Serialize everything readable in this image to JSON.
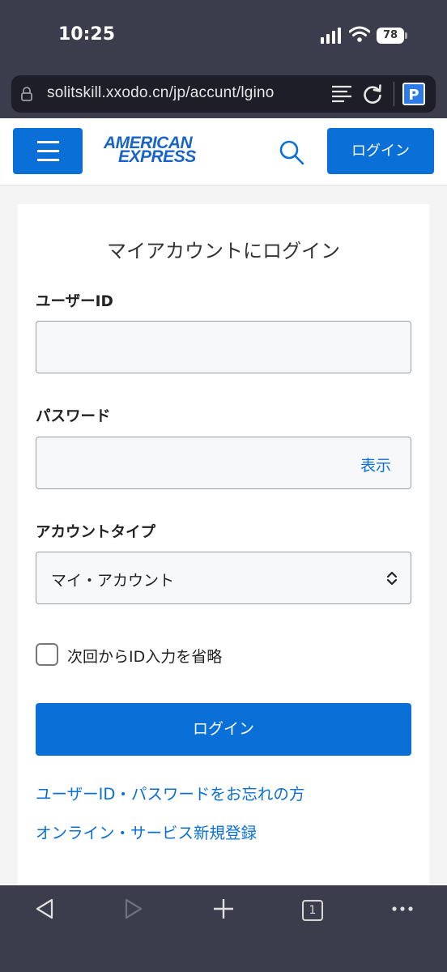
{
  "status_bar": {
    "time": "10:25",
    "battery": "78",
    "icons": [
      "signal-icon",
      "wifi-icon",
      "battery-icon"
    ]
  },
  "browser": {
    "url": "solitskill.xxodo.cn/jp/accunt/lgino",
    "icons": [
      "lock-icon",
      "reader-icon",
      "reload-icon",
      "extension-icon"
    ],
    "extension_label": "P",
    "tabs_count": "1"
  },
  "header": {
    "logo_line1": "AMERICAN",
    "logo_line2": "EXPRESS",
    "login_button": "ログイン",
    "icons": [
      "menu-icon",
      "search-icon"
    ]
  },
  "form": {
    "title": "マイアカウントにログイン",
    "user_id_label": "ユーザーID",
    "user_id_value": "",
    "password_label": "パスワード",
    "password_value": "",
    "show_password": "表示",
    "account_type_label": "アカウントタイプ",
    "account_type_selected": "マイ・アカウント",
    "remember_label": "次回からID入力を省略",
    "remember_checked": false,
    "login_button": "ログイン",
    "forgot_link": "ユーザーID・パスワードをお忘れの方",
    "register_link": "オンライン・サービス新規登録"
  },
  "colors": {
    "brand_blue": "#0a6fd6",
    "chrome_bg": "#3b3d4d",
    "card_bg": "#ffffff",
    "page_bg": "#f4f4f4"
  }
}
